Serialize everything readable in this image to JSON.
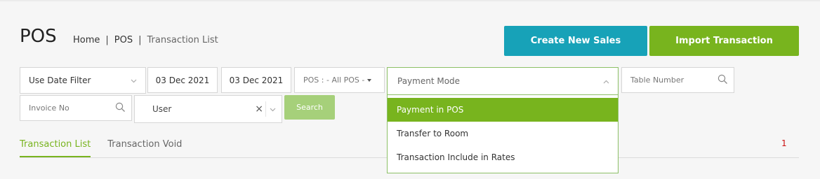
{
  "page": {
    "title": "POS"
  },
  "breadcrumb": {
    "items": [
      "Home",
      "POS",
      "Transaction List"
    ],
    "separator": "|"
  },
  "actions": {
    "create_label": "Create New Sales",
    "import_label": "Import Transaction"
  },
  "filters": {
    "date_filter": "Use Date Filter",
    "date_from": "03 Dec 2021",
    "date_to": "03 Dec 2021",
    "pos": "POS : - All POS -",
    "payment_mode": "Payment Mode",
    "table_number_placeholder": "Table Number",
    "invoice_placeholder": "Invoice No",
    "user": "User",
    "search_label": "Search"
  },
  "payment_dropdown": {
    "options": [
      "Payment in POS",
      "Transfer to Room",
      "Transaction Include in Rates"
    ],
    "selected": "Payment in POS"
  },
  "tabs": {
    "items": [
      "Transaction List",
      "Transaction Void"
    ],
    "active": "Transaction List"
  },
  "counter": "1",
  "colors": {
    "primary_green": "#78b41e",
    "teal": "#17a2b8",
    "search_green": "#a6d07a",
    "counter_red": "#cc1111"
  }
}
